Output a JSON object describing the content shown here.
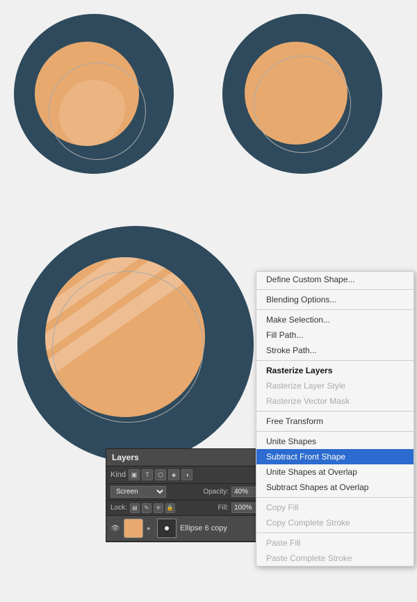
{
  "canvas": {
    "background": "#f0f0f0"
  },
  "context_menu": {
    "items": [
      {
        "id": "define-custom-shape",
        "label": "Define Custom Shape...",
        "state": "normal",
        "separator_after": false
      },
      {
        "id": "blending-options",
        "label": "Blending Options...",
        "state": "normal",
        "separator_after": true
      },
      {
        "id": "make-selection",
        "label": "Make Selection...",
        "state": "normal",
        "separator_after": false
      },
      {
        "id": "fill-path",
        "label": "Fill Path...",
        "state": "normal",
        "separator_after": false
      },
      {
        "id": "stroke-path",
        "label": "Stroke Path...",
        "state": "normal",
        "separator_after": true
      },
      {
        "id": "rasterize-layers",
        "label": "Rasterize Layers",
        "state": "bold",
        "separator_after": false
      },
      {
        "id": "rasterize-layer-style",
        "label": "Rasterize Layer Style",
        "state": "disabled",
        "separator_after": false
      },
      {
        "id": "rasterize-vector-mask",
        "label": "Rasterize Vector Mask",
        "state": "disabled",
        "separator_after": true
      },
      {
        "id": "free-transform",
        "label": "Free Transform",
        "state": "normal",
        "separator_after": true
      },
      {
        "id": "unite-shapes",
        "label": "Unite Shapes",
        "state": "normal",
        "separator_after": false
      },
      {
        "id": "subtract-front-shape",
        "label": "Subtract Front Shape",
        "state": "highlighted",
        "separator_after": false
      },
      {
        "id": "unite-shapes-at-overlap",
        "label": "Unite Shapes at Overlap",
        "state": "normal",
        "separator_after": false
      },
      {
        "id": "subtract-shapes-at-overlap",
        "label": "Subtract Shapes at Overlap",
        "state": "normal",
        "separator_after": true
      },
      {
        "id": "copy-fill",
        "label": "Copy Fill",
        "state": "disabled",
        "separator_after": false
      },
      {
        "id": "copy-complete-stroke",
        "label": "Copy Complete Stroke",
        "state": "disabled",
        "separator_after": true
      },
      {
        "id": "paste-fill",
        "label": "Paste Fill",
        "state": "disabled",
        "separator_after": false
      },
      {
        "id": "paste-complete-stroke",
        "label": "Paste Complete Stroke",
        "state": "disabled",
        "separator_after": false
      }
    ]
  },
  "layers_panel": {
    "title": "Layers",
    "filter_label": "Kind",
    "blend_mode": "Screen",
    "opacity_label": "Opacity:",
    "opacity_value": "40%",
    "lock_label": "Lock:",
    "fill_label": "Fill:",
    "fill_value": "100%",
    "layer": {
      "name": "Ellipse 6 copy",
      "thumb_color": "#e8a96e"
    }
  },
  "icons": {
    "eye": "👁",
    "link": "🔗"
  }
}
